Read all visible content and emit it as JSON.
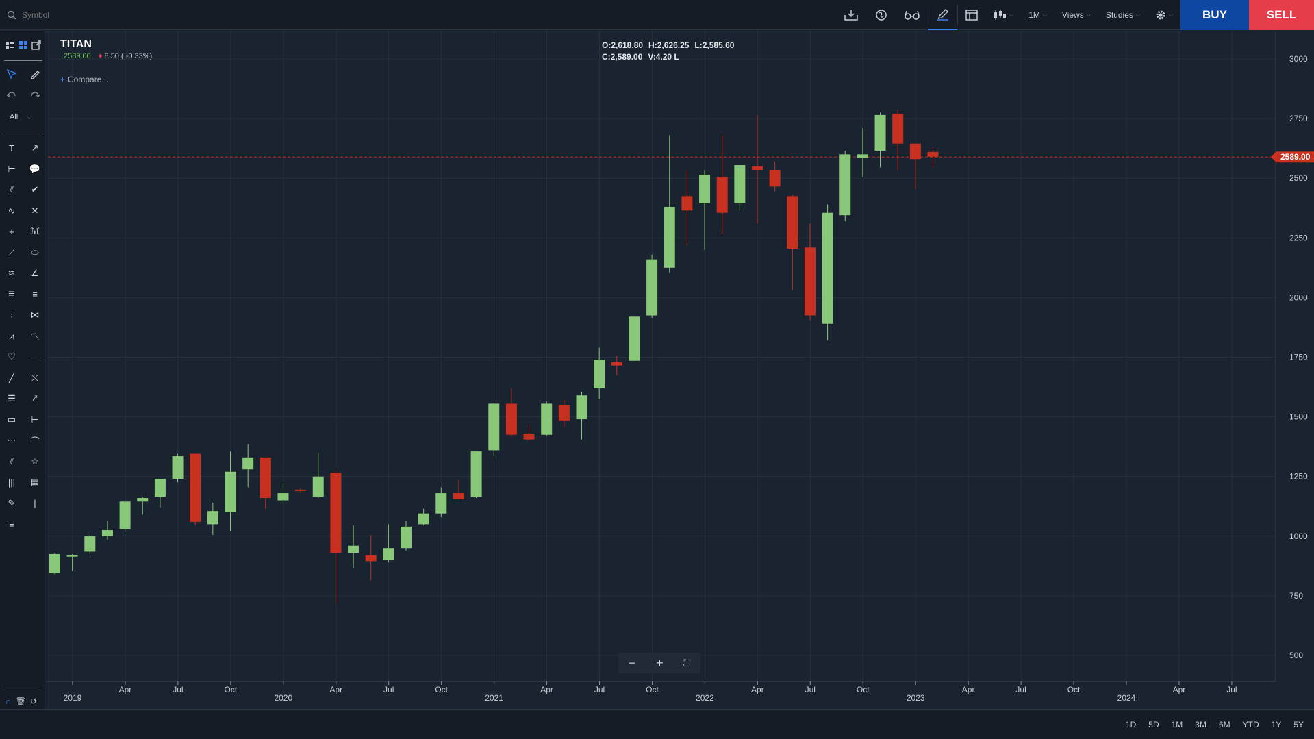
{
  "search": {
    "placeholder": "Symbol"
  },
  "toolbar": {
    "interval_label": "1M",
    "views_label": "Views",
    "studies_label": "Studies",
    "buy_label": "BUY",
    "sell_label": "SELL"
  },
  "sidebar": {
    "filter_label": "All"
  },
  "symbol": {
    "name": "TITAN",
    "last": "2589.00",
    "change": "8.50 ( -0.33%)",
    "compare_label": "Compare..."
  },
  "ohlc": {
    "open": "O:2,618.80",
    "high": "H:2,626.25",
    "low": "L:2,585.60",
    "close": "C:2,589.00",
    "volume": "V:4.20 L"
  },
  "price_tag": "2589.00",
  "ranges": [
    "1D",
    "5D",
    "1M",
    "3M",
    "6M",
    "YTD",
    "1Y",
    "5Y"
  ],
  "colors": {
    "background": "#1a2330",
    "up": "#8ac879",
    "down": "#c8311f",
    "grid": "#27313d",
    "buy": "#0d47a1",
    "sell": "#e53e4a"
  },
  "chart_data": {
    "type": "candlestick",
    "interval": "monthly",
    "ylim": [
      500,
      3000
    ],
    "yticks": [
      3000,
      2750,
      2500,
      2250,
      2000,
      1750,
      1500,
      1250,
      1000,
      750,
      500
    ],
    "x_axis_labels": [
      "2019",
      "Apr",
      "Jul",
      "Oct",
      "2020",
      "Apr",
      "Jul",
      "Oct",
      "2021",
      "Apr",
      "Jul",
      "Oct",
      "2022",
      "Apr",
      "Jul",
      "Oct",
      "2023",
      "Apr",
      "Jul",
      "Oct",
      "2024",
      "Apr",
      "Jul"
    ],
    "candles": [
      {
        "date": "2019-01",
        "o": 845,
        "h": 930,
        "l": 840,
        "c": 925
      },
      {
        "date": "2019-02",
        "o": 920,
        "h": 925,
        "l": 855,
        "c": 920
      },
      {
        "date": "2019-03",
        "o": 935,
        "h": 1005,
        "l": 925,
        "c": 1000
      },
      {
        "date": "2019-04",
        "o": 1000,
        "h": 1065,
        "l": 985,
        "c": 1025
      },
      {
        "date": "2019-05",
        "o": 1030,
        "h": 1150,
        "l": 1015,
        "c": 1145
      },
      {
        "date": "2019-06",
        "o": 1145,
        "h": 1165,
        "l": 1090,
        "c": 1160
      },
      {
        "date": "2019-07",
        "o": 1165,
        "h": 1225,
        "l": 1120,
        "c": 1240
      },
      {
        "date": "2019-08",
        "o": 1240,
        "h": 1345,
        "l": 1225,
        "c": 1335
      },
      {
        "date": "2019-09",
        "o": 1345,
        "h": 1345,
        "l": 1045,
        "c": 1060
      },
      {
        "date": "2019-10",
        "o": 1050,
        "h": 1140,
        "l": 1005,
        "c": 1105
      },
      {
        "date": "2019-11",
        "o": 1100,
        "h": 1355,
        "l": 1020,
        "c": 1270
      },
      {
        "date": "2019-12",
        "o": 1280,
        "h": 1385,
        "l": 1205,
        "c": 1330
      },
      {
        "date": "2020-01",
        "o": 1330,
        "h": 1330,
        "l": 1115,
        "c": 1160
      },
      {
        "date": "2020-02",
        "o": 1150,
        "h": 1225,
        "l": 1140,
        "c": 1180
      },
      {
        "date": "2020-03",
        "o": 1195,
        "h": 1200,
        "l": 1180,
        "c": 1190
      },
      {
        "date": "2020-04",
        "o": 1165,
        "h": 1350,
        "l": 1160,
        "c": 1250
      },
      {
        "date": "2020-05",
        "o": 1265,
        "h": 1280,
        "l": 720,
        "c": 930
      },
      {
        "date": "2020-06",
        "o": 930,
        "h": 1045,
        "l": 865,
        "c": 960
      },
      {
        "date": "2020-07",
        "o": 920,
        "h": 1005,
        "l": 815,
        "c": 895
      },
      {
        "date": "2020-08",
        "o": 900,
        "h": 1050,
        "l": 890,
        "c": 950
      },
      {
        "date": "2020-09",
        "o": 950,
        "h": 1065,
        "l": 940,
        "c": 1040
      },
      {
        "date": "2020-10",
        "o": 1050,
        "h": 1115,
        "l": 1045,
        "c": 1095
      },
      {
        "date": "2020-11",
        "o": 1095,
        "h": 1205,
        "l": 1080,
        "c": 1180
      },
      {
        "date": "2020-12",
        "o": 1180,
        "h": 1235,
        "l": 1160,
        "c": 1155
      },
      {
        "date": "2021-01",
        "o": 1165,
        "h": 1325,
        "l": 1160,
        "c": 1355
      },
      {
        "date": "2021-02",
        "o": 1360,
        "h": 1560,
        "l": 1335,
        "c": 1555
      },
      {
        "date": "2021-03",
        "o": 1555,
        "h": 1620,
        "l": 1420,
        "c": 1425
      },
      {
        "date": "2021-04",
        "o": 1430,
        "h": 1465,
        "l": 1395,
        "c": 1405
      },
      {
        "date": "2021-05",
        "o": 1425,
        "h": 1565,
        "l": 1420,
        "c": 1555
      },
      {
        "date": "2021-06",
        "o": 1550,
        "h": 1570,
        "l": 1455,
        "c": 1485
      },
      {
        "date": "2021-07",
        "o": 1490,
        "h": 1605,
        "l": 1405,
        "c": 1590
      },
      {
        "date": "2021-08",
        "o": 1620,
        "h": 1790,
        "l": 1575,
        "c": 1740
      },
      {
        "date": "2021-09",
        "o": 1730,
        "h": 1755,
        "l": 1675,
        "c": 1715
      },
      {
        "date": "2021-10",
        "o": 1735,
        "h": 1740,
        "l": 1735,
        "c": 1920
      },
      {
        "date": "2021-11",
        "o": 1925,
        "h": 2180,
        "l": 1915,
        "c": 2160
      },
      {
        "date": "2021-12",
        "o": 2125,
        "h": 2680,
        "l": 2105,
        "c": 2380
      },
      {
        "date": "2022-01",
        "o": 2425,
        "h": 2535,
        "l": 2220,
        "c": 2365
      },
      {
        "date": "2022-02",
        "o": 2395,
        "h": 2535,
        "l": 2200,
        "c": 2515
      },
      {
        "date": "2022-03",
        "o": 2505,
        "h": 2680,
        "l": 2265,
        "c": 2355
      },
      {
        "date": "2022-04",
        "o": 2395,
        "h": 2555,
        "l": 2365,
        "c": 2555
      },
      {
        "date": "2022-05",
        "o": 2550,
        "h": 2765,
        "l": 2310,
        "c": 2535
      },
      {
        "date": "2022-06",
        "o": 2535,
        "h": 2570,
        "l": 2445,
        "c": 2465
      },
      {
        "date": "2022-07",
        "o": 2425,
        "h": 2430,
        "l": 2030,
        "c": 2205
      },
      {
        "date": "2022-08",
        "o": 2210,
        "h": 2310,
        "l": 1905,
        "c": 1925
      },
      {
        "date": "2022-09",
        "o": 1890,
        "h": 2390,
        "l": 1820,
        "c": 2355
      },
      {
        "date": "2022-10",
        "o": 2345,
        "h": 2615,
        "l": 2320,
        "c": 2600
      },
      {
        "date": "2022-11",
        "o": 2585,
        "h": 2710,
        "l": 2505,
        "c": 2600
      },
      {
        "date": "2022-12",
        "o": 2615,
        "h": 2775,
        "l": 2545,
        "c": 2765
      },
      {
        "date": "2023-01",
        "o": 2770,
        "h": 2785,
        "l": 2535,
        "c": 2645
      },
      {
        "date": "2023-02",
        "o": 2645,
        "h": 2645,
        "l": 2455,
        "c": 2580
      },
      {
        "date": "2023-03",
        "o": 2610,
        "h": 2630,
        "l": 2545,
        "c": 2590
      }
    ]
  }
}
